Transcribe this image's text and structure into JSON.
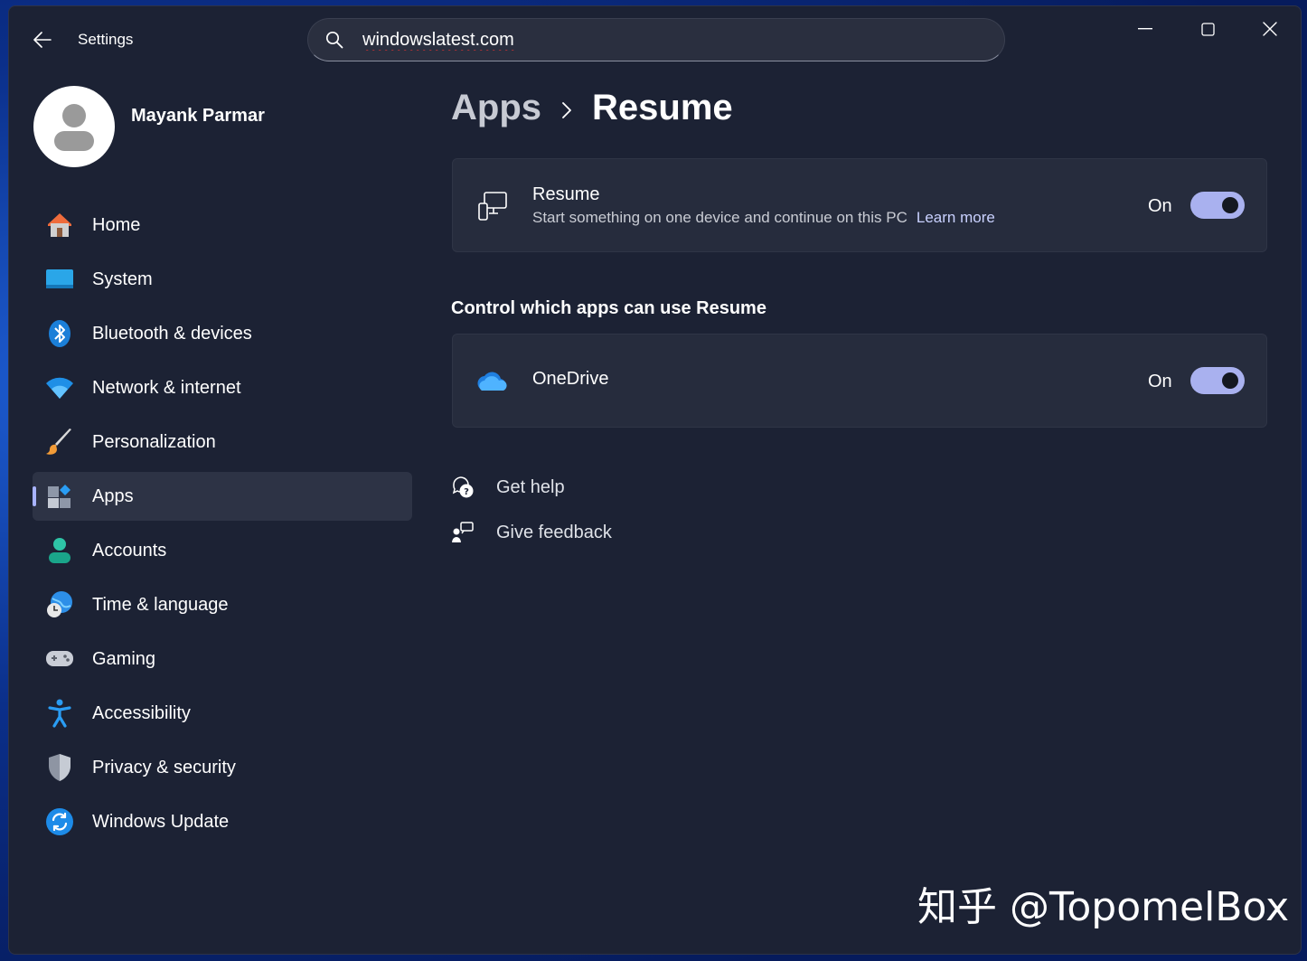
{
  "window": {
    "app_title": "Settings"
  },
  "search": {
    "value": "windowslatest.com"
  },
  "profile": {
    "name": "Mayank Parmar"
  },
  "nav": {
    "items": [
      {
        "label": "Home",
        "icon": "home-icon"
      },
      {
        "label": "System",
        "icon": "monitor-icon"
      },
      {
        "label": "Bluetooth & devices",
        "icon": "bluetooth-icon"
      },
      {
        "label": "Network & internet",
        "icon": "wifi-icon"
      },
      {
        "label": "Personalization",
        "icon": "paintbrush-icon"
      },
      {
        "label": "Apps",
        "icon": "apps-icon",
        "active": true
      },
      {
        "label": "Accounts",
        "icon": "person-icon"
      },
      {
        "label": "Time & language",
        "icon": "globe-clock-icon"
      },
      {
        "label": "Gaming",
        "icon": "gamepad-icon"
      },
      {
        "label": "Accessibility",
        "icon": "accessibility-icon"
      },
      {
        "label": "Privacy & security",
        "icon": "shield-icon"
      },
      {
        "label": "Windows Update",
        "icon": "update-icon"
      }
    ]
  },
  "breadcrumb": {
    "parent": "Apps",
    "current": "Resume"
  },
  "resume_card": {
    "title": "Resume",
    "description": "Start something on one device and continue on this PC",
    "learn_more": "Learn more",
    "state": "On"
  },
  "section": {
    "heading": "Control which apps can use Resume"
  },
  "onedrive_card": {
    "title": "OneDrive",
    "state": "On"
  },
  "help": {
    "get_help": "Get help",
    "give_feedback": "Give feedback"
  },
  "watermark": "知乎 @TopomelBox",
  "colors": {
    "window_bg": "#1c2234",
    "card_bg": "#262c3d",
    "accent": "#a9b1ef",
    "active_nav_bg": "#2d3345"
  }
}
